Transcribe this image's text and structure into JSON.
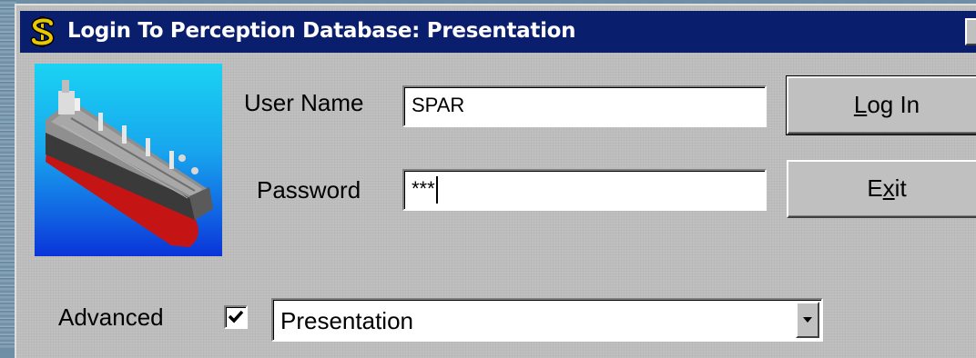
{
  "window": {
    "title": "Login To Perception Database: Presentation",
    "close_label": "✕"
  },
  "form": {
    "username_label": "User Name",
    "username_value": "SPAR",
    "password_label": "Password",
    "password_value": "***",
    "advanced_label": "Advanced",
    "advanced_checked": true,
    "database_value": "Presentation"
  },
  "buttons": {
    "login_prefix": "",
    "login_accel": "L",
    "login_rest": "og In",
    "exit_prefix": "E",
    "exit_accel": "x",
    "exit_rest": "it"
  },
  "icons": {
    "app_icon": "dollar-icon",
    "image": "ship-tanker-image",
    "checkbox_mark": "checkmark-icon",
    "dropdown": "dropdown-arrow-icon"
  },
  "colors": {
    "titlebar": "#0a1e6e",
    "dialog_bg": "#c0c0c0",
    "dollar": "#e8c800",
    "ship_hull": "#d01818",
    "ship_bg_top": "#1ad3f3",
    "ship_bg_bottom": "#0a33d8"
  }
}
